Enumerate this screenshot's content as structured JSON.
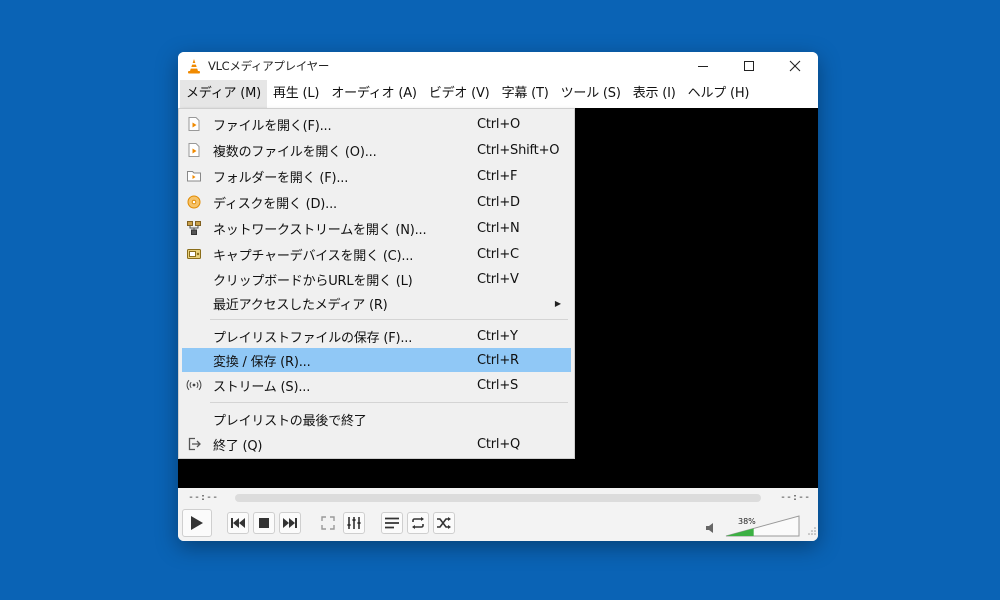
{
  "window": {
    "title": "VLCメディアプレイヤー",
    "controls": [
      "minimize-icon",
      "maximize-icon",
      "close-icon"
    ]
  },
  "menubar": [
    {
      "label": "メディア (M)",
      "active": true
    },
    {
      "label": "再生 (L)"
    },
    {
      "label": "オーディオ (A)"
    },
    {
      "label": "ビデオ (V)"
    },
    {
      "label": "字幕 (T)"
    },
    {
      "label": "ツール (S)"
    },
    {
      "label": "表示 (I)"
    },
    {
      "label": "ヘルプ (H)"
    }
  ],
  "media_menu": {
    "items": [
      {
        "label": "ファイルを開く(F)...",
        "shortcut": "Ctrl+O",
        "icon": "file-icon"
      },
      {
        "label": "複数のファイルを開く (O)...",
        "shortcut": "Ctrl+Shift+O",
        "icon": "multiple-files-icon"
      },
      {
        "label": "フォルダーを開く (F)...",
        "shortcut": "Ctrl+F",
        "icon": "folder-icon"
      },
      {
        "label": "ディスクを開く (D)...",
        "shortcut": "Ctrl+D",
        "icon": "disc-icon"
      },
      {
        "label": "ネットワークストリームを開く (N)...",
        "shortcut": "Ctrl+N",
        "icon": "network-icon"
      },
      {
        "label": "キャプチャーデバイスを開く (C)...",
        "shortcut": "Ctrl+C",
        "icon": "capture-device-icon"
      },
      {
        "label": "クリップボードからURLを開く (L)",
        "shortcut": "Ctrl+V",
        "icon": ""
      },
      {
        "label": "最近アクセスしたメディア (R)",
        "shortcut": "",
        "icon": "",
        "submenu": true
      },
      {
        "label": "プレイリストファイルの保存 (F)...",
        "shortcut": "Ctrl+Y",
        "icon": ""
      },
      {
        "label": "変換 / 保存 (R)...",
        "shortcut": "Ctrl+R",
        "icon": "",
        "highlighted": true
      },
      {
        "label": "ストリーム (S)...",
        "shortcut": "Ctrl+S",
        "icon": "stream-icon"
      },
      {
        "label": "プレイリストの最後で終了",
        "shortcut": "",
        "icon": ""
      },
      {
        "label": "終了 (Q)",
        "shortcut": "Ctrl+Q",
        "icon": "exit-icon"
      }
    ]
  },
  "player": {
    "elapsed": "--:--",
    "remaining": "--:--",
    "volume": "38%",
    "volume_fraction": 0.38
  },
  "colors": {
    "desktop": "#0a63b5",
    "highlight": "#90c8f6",
    "volume_fill": "#3cb043",
    "vlc_orange": "#f08a00"
  }
}
